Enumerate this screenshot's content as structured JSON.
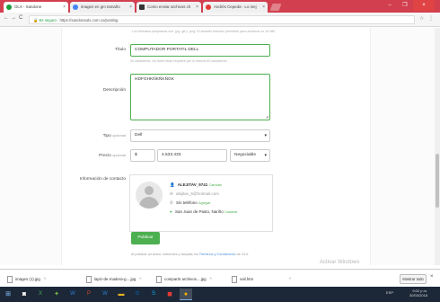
{
  "browser": {
    "tabs": [
      {
        "label": "OLX - Sandone",
        "color": "#1a9c3d"
      },
      {
        "label": "imagen en gm tamaño",
        "color": "#4285f4"
      },
      {
        "label": "Como enviar archivos ch",
        "color": "#333333"
      },
      {
        "label": "Andrés Cepeda - Lo mej",
        "color": "#e53935"
      }
    ],
    "secure_label": "Es seguro",
    "url": "https://sandonaolx.com.co/posting"
  },
  "form": {
    "top_hint": "Los formatos aceptados son .jpg .gif y .png. El tamaño máximo permitido para archivos es 10 MB.",
    "title_label": "Título",
    "title_value": "COMPUTADOR PORTATIL DELL",
    "title_hint": "20 caracteres. Un buen título requiere por lo menos 60 caracteres",
    "description_label": "Descripción",
    "description_value": "HDFGHKÑKÑKÑGK",
    "type_label": "Tipo",
    "type_optional": "opcional",
    "type_value": "Dell",
    "price_label": "Precio",
    "price_optional": "opcional",
    "currency": "$",
    "price_value": "4.533.433",
    "negotiable_value": "Negociable",
    "contact_label": "Información de contacto"
  },
  "contact": {
    "username": "ALEJITAV_9741",
    "username_action": "Cambiar",
    "email": "alejitav_5@hotmail.com",
    "phone": "Sin teléfono",
    "phone_action": "Agregar",
    "location": "San Juan de Pasto, Nariño",
    "location_action": "Cambiar"
  },
  "publish_button": "Publicar",
  "terms": {
    "prefix": "Al publicar un aviso, entiendes y aceptas los ",
    "link": "Términos y Condiciones",
    "suffix": " de OLX."
  },
  "watermark": {
    "line1": "Activar Windows",
    "line2": "Ve a Configuración para activar Windows."
  },
  "downloads": {
    "items": [
      "images (1).jpg",
      "lapiz-de-madera-g....jpg",
      "compartir archivos....jpg",
      "vail.htm"
    ],
    "show_all": "Mostrar todo"
  },
  "taskbar": {
    "time": "9:02 p.m.",
    "date": "30/03/2018",
    "lang": "ESP"
  },
  "colors": {
    "accent": "#4caf50",
    "tabbar": "#d23f4e",
    "link": "#4a90d9"
  }
}
